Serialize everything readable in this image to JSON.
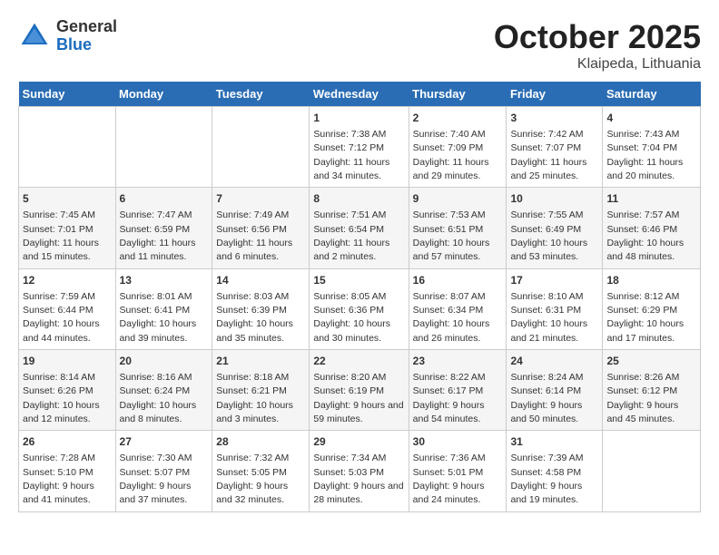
{
  "logo": {
    "general": "General",
    "blue": "Blue"
  },
  "title": "October 2025",
  "subtitle": "Klaipeda, Lithuania",
  "days_of_week": [
    "Sunday",
    "Monday",
    "Tuesday",
    "Wednesday",
    "Thursday",
    "Friday",
    "Saturday"
  ],
  "weeks": [
    [
      {
        "day": "",
        "sunrise": "",
        "sunset": "",
        "daylight": ""
      },
      {
        "day": "",
        "sunrise": "",
        "sunset": "",
        "daylight": ""
      },
      {
        "day": "",
        "sunrise": "",
        "sunset": "",
        "daylight": ""
      },
      {
        "day": "1",
        "sunrise": "Sunrise: 7:38 AM",
        "sunset": "Sunset: 7:12 PM",
        "daylight": "Daylight: 11 hours and 34 minutes."
      },
      {
        "day": "2",
        "sunrise": "Sunrise: 7:40 AM",
        "sunset": "Sunset: 7:09 PM",
        "daylight": "Daylight: 11 hours and 29 minutes."
      },
      {
        "day": "3",
        "sunrise": "Sunrise: 7:42 AM",
        "sunset": "Sunset: 7:07 PM",
        "daylight": "Daylight: 11 hours and 25 minutes."
      },
      {
        "day": "4",
        "sunrise": "Sunrise: 7:43 AM",
        "sunset": "Sunset: 7:04 PM",
        "daylight": "Daylight: 11 hours and 20 minutes."
      }
    ],
    [
      {
        "day": "5",
        "sunrise": "Sunrise: 7:45 AM",
        "sunset": "Sunset: 7:01 PM",
        "daylight": "Daylight: 11 hours and 15 minutes."
      },
      {
        "day": "6",
        "sunrise": "Sunrise: 7:47 AM",
        "sunset": "Sunset: 6:59 PM",
        "daylight": "Daylight: 11 hours and 11 minutes."
      },
      {
        "day": "7",
        "sunrise": "Sunrise: 7:49 AM",
        "sunset": "Sunset: 6:56 PM",
        "daylight": "Daylight: 11 hours and 6 minutes."
      },
      {
        "day": "8",
        "sunrise": "Sunrise: 7:51 AM",
        "sunset": "Sunset: 6:54 PM",
        "daylight": "Daylight: 11 hours and 2 minutes."
      },
      {
        "day": "9",
        "sunrise": "Sunrise: 7:53 AM",
        "sunset": "Sunset: 6:51 PM",
        "daylight": "Daylight: 10 hours and 57 minutes."
      },
      {
        "day": "10",
        "sunrise": "Sunrise: 7:55 AM",
        "sunset": "Sunset: 6:49 PM",
        "daylight": "Daylight: 10 hours and 53 minutes."
      },
      {
        "day": "11",
        "sunrise": "Sunrise: 7:57 AM",
        "sunset": "Sunset: 6:46 PM",
        "daylight": "Daylight: 10 hours and 48 minutes."
      }
    ],
    [
      {
        "day": "12",
        "sunrise": "Sunrise: 7:59 AM",
        "sunset": "Sunset: 6:44 PM",
        "daylight": "Daylight: 10 hours and 44 minutes."
      },
      {
        "day": "13",
        "sunrise": "Sunrise: 8:01 AM",
        "sunset": "Sunset: 6:41 PM",
        "daylight": "Daylight: 10 hours and 39 minutes."
      },
      {
        "day": "14",
        "sunrise": "Sunrise: 8:03 AM",
        "sunset": "Sunset: 6:39 PM",
        "daylight": "Daylight: 10 hours and 35 minutes."
      },
      {
        "day": "15",
        "sunrise": "Sunrise: 8:05 AM",
        "sunset": "Sunset: 6:36 PM",
        "daylight": "Daylight: 10 hours and 30 minutes."
      },
      {
        "day": "16",
        "sunrise": "Sunrise: 8:07 AM",
        "sunset": "Sunset: 6:34 PM",
        "daylight": "Daylight: 10 hours and 26 minutes."
      },
      {
        "day": "17",
        "sunrise": "Sunrise: 8:10 AM",
        "sunset": "Sunset: 6:31 PM",
        "daylight": "Daylight: 10 hours and 21 minutes."
      },
      {
        "day": "18",
        "sunrise": "Sunrise: 8:12 AM",
        "sunset": "Sunset: 6:29 PM",
        "daylight": "Daylight: 10 hours and 17 minutes."
      }
    ],
    [
      {
        "day": "19",
        "sunrise": "Sunrise: 8:14 AM",
        "sunset": "Sunset: 6:26 PM",
        "daylight": "Daylight: 10 hours and 12 minutes."
      },
      {
        "day": "20",
        "sunrise": "Sunrise: 8:16 AM",
        "sunset": "Sunset: 6:24 PM",
        "daylight": "Daylight: 10 hours and 8 minutes."
      },
      {
        "day": "21",
        "sunrise": "Sunrise: 8:18 AM",
        "sunset": "Sunset: 6:21 PM",
        "daylight": "Daylight: 10 hours and 3 minutes."
      },
      {
        "day": "22",
        "sunrise": "Sunrise: 8:20 AM",
        "sunset": "Sunset: 6:19 PM",
        "daylight": "Daylight: 9 hours and 59 minutes."
      },
      {
        "day": "23",
        "sunrise": "Sunrise: 8:22 AM",
        "sunset": "Sunset: 6:17 PM",
        "daylight": "Daylight: 9 hours and 54 minutes."
      },
      {
        "day": "24",
        "sunrise": "Sunrise: 8:24 AM",
        "sunset": "Sunset: 6:14 PM",
        "daylight": "Daylight: 9 hours and 50 minutes."
      },
      {
        "day": "25",
        "sunrise": "Sunrise: 8:26 AM",
        "sunset": "Sunset: 6:12 PM",
        "daylight": "Daylight: 9 hours and 45 minutes."
      }
    ],
    [
      {
        "day": "26",
        "sunrise": "Sunrise: 7:28 AM",
        "sunset": "Sunset: 5:10 PM",
        "daylight": "Daylight: 9 hours and 41 minutes."
      },
      {
        "day": "27",
        "sunrise": "Sunrise: 7:30 AM",
        "sunset": "Sunset: 5:07 PM",
        "daylight": "Daylight: 9 hours and 37 minutes."
      },
      {
        "day": "28",
        "sunrise": "Sunrise: 7:32 AM",
        "sunset": "Sunset: 5:05 PM",
        "daylight": "Daylight: 9 hours and 32 minutes."
      },
      {
        "day": "29",
        "sunrise": "Sunrise: 7:34 AM",
        "sunset": "Sunset: 5:03 PM",
        "daylight": "Daylight: 9 hours and 28 minutes."
      },
      {
        "day": "30",
        "sunrise": "Sunrise: 7:36 AM",
        "sunset": "Sunset: 5:01 PM",
        "daylight": "Daylight: 9 hours and 24 minutes."
      },
      {
        "day": "31",
        "sunrise": "Sunrise: 7:39 AM",
        "sunset": "Sunset: 4:58 PM",
        "daylight": "Daylight: 9 hours and 19 minutes."
      },
      {
        "day": "",
        "sunrise": "",
        "sunset": "",
        "daylight": ""
      }
    ]
  ]
}
